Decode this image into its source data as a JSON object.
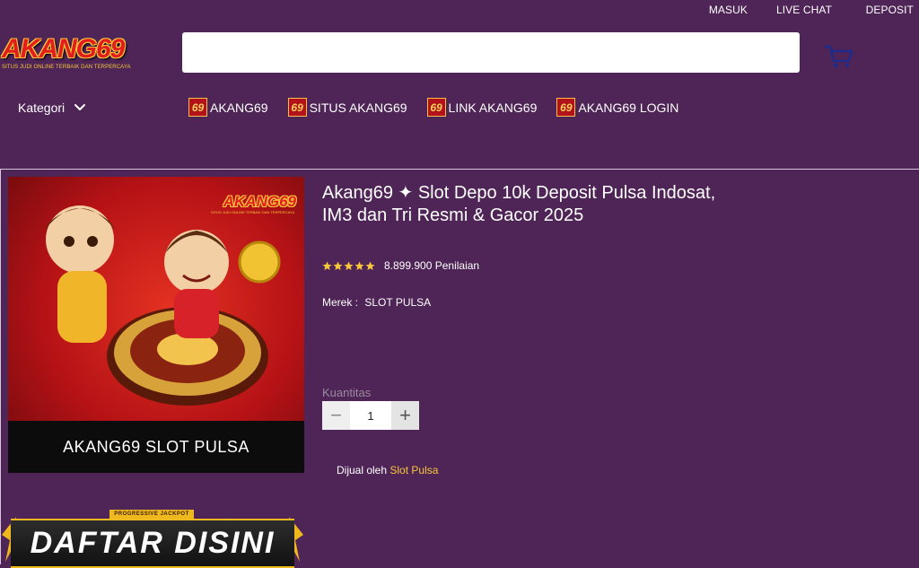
{
  "header": {
    "links": [
      "MASUK",
      "LIVE CHAT",
      "DEPOSIT"
    ],
    "logo": {
      "wordmark": "AKANG69",
      "tagline": "SITUS JUDI ONLINE TERBAIK DAN TERPERCAYA"
    },
    "search": {
      "value": "",
      "placeholder": ""
    },
    "cart_icon": "cart-icon"
  },
  "nav": {
    "kategori_label": "Kategori",
    "badge_text": "69",
    "items": [
      {
        "label": "AKANG69"
      },
      {
        "label": "SITUS AKANG69"
      },
      {
        "label": "LINK AKANG69"
      },
      {
        "label": "AKANG69 LOGIN"
      }
    ]
  },
  "product": {
    "image": {
      "logo_text": "AKANG69",
      "logo_tagline": "SITUS JUDI ONLINE TERBAIK DAN TERPERCAYA",
      "caption": "AKANG69 SLOT PULSA"
    },
    "banner": {
      "jackpot_tag": "PROGRESSIVE JACKPOT",
      "text": "DAFTAR DISINI"
    },
    "title": "Akang69 ✦ Slot Depo 10k Deposit Pulsa Indosat, IM3 dan Tri Resmi & Gacor 2025",
    "rating": {
      "stars": 5,
      "count_text": "8.899.900 Penilaian"
    },
    "brand": {
      "label": "Merek :",
      "value": "SLOT PULSA"
    },
    "quantity": {
      "label": "Kuantitas",
      "value": "1",
      "minus": "−",
      "plus": "+"
    },
    "seller": {
      "prefix": "Dijual oleh",
      "name": "Slot Pulsa"
    }
  },
  "colors": {
    "background": "#4e2556",
    "accent_gold": "#f7c63b",
    "brand_red": "#e11d1d",
    "cart_blue": "#1f2a8a"
  }
}
